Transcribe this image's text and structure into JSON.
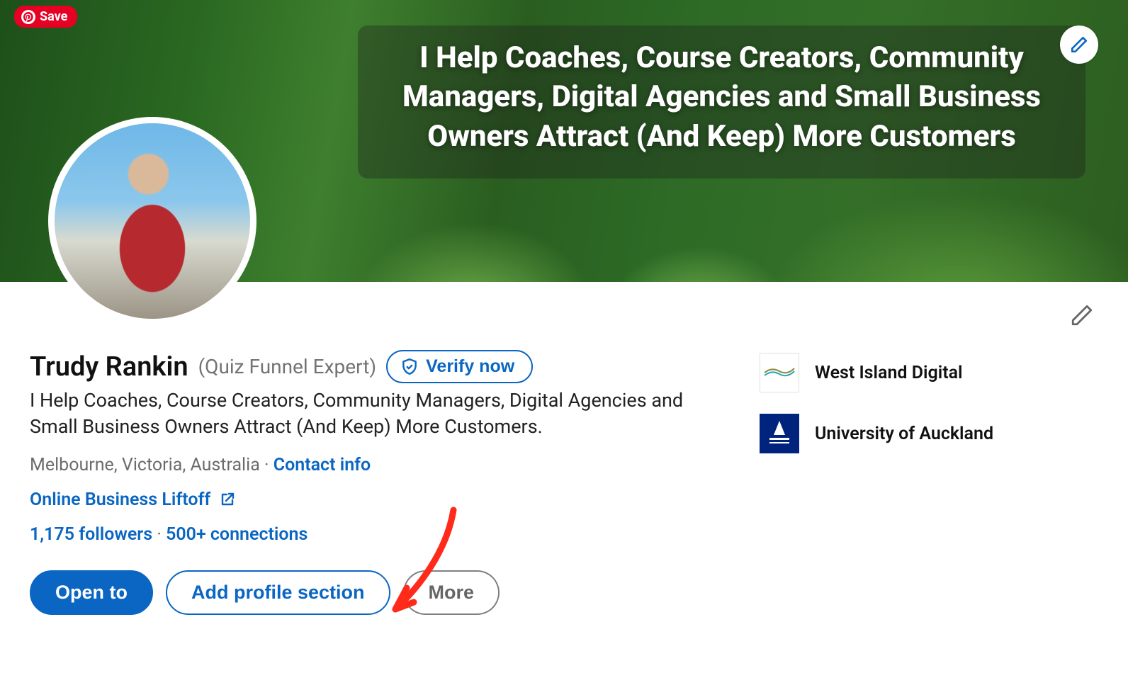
{
  "pinterest": {
    "label": "Save"
  },
  "cover": {
    "tagline": "I Help Coaches, Course Creators, Community Managers, Digital Agencies and Small Business Owners Attract (And Keep) More Customers"
  },
  "profile": {
    "name": "Trudy Rankin",
    "pronoun": "(Quiz Funnel Expert)",
    "verify_label": "Verify now",
    "headline": "I Help Coaches, Course Creators, Community Managers, Digital Agencies and Small Business Owners Attract (And Keep) More Customers.",
    "location": "Melbourne, Victoria, Australia",
    "location_separator": " · ",
    "contact_label": "Contact info",
    "website_label": "Online Business Liftoff",
    "followers": "1,175 followers",
    "stats_separator": "  · ",
    "connections": "500+ connections"
  },
  "actions": {
    "open_to": "Open to",
    "add_section": "Add profile section",
    "more": "More"
  },
  "organizations": [
    {
      "name": "West Island Digital",
      "logo_style": "wid"
    },
    {
      "name": "University of Auckland",
      "logo_style": "uoa"
    }
  ]
}
